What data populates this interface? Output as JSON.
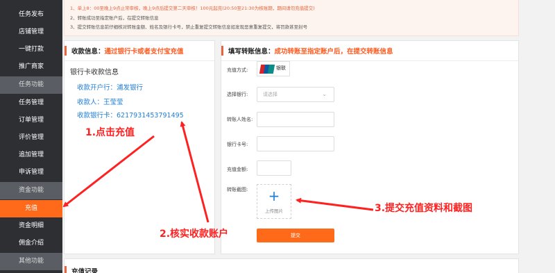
{
  "sidebar": {
    "items": [
      {
        "label": "任务发布",
        "type": "item"
      },
      {
        "label": "店铺管理",
        "type": "item"
      },
      {
        "label": "一键打款",
        "type": "item"
      },
      {
        "label": "推广商家",
        "type": "item"
      },
      {
        "label": "任务功能",
        "type": "section"
      },
      {
        "label": "任务管理",
        "type": "item"
      },
      {
        "label": "订单管理",
        "type": "item"
      },
      {
        "label": "评价管理",
        "type": "item"
      },
      {
        "label": "追加管理",
        "type": "item"
      },
      {
        "label": "申诉管理",
        "type": "item"
      },
      {
        "label": "资金功能",
        "type": "section"
      },
      {
        "label": "充值",
        "type": "active"
      },
      {
        "label": "资金明细",
        "type": "item"
      },
      {
        "label": "佣金介绍",
        "type": "item"
      },
      {
        "label": "其他功能",
        "type": "section"
      }
    ]
  },
  "notice": {
    "lines": [
      "1、单上8：00至晚上9点止常审核，晚上9点后提交第二天审核！100元起充(20:50至21:30为核账期，期间请勿充值提交)",
      "2、转账成功至指定账户后，在提交转账信息",
      "3、提交转账信息前仔细核对转账金额、姓名及银行卡号，禁止重复提交转账信息如发现恶意重复提交，将罚款甚至封号"
    ]
  },
  "receive_panel": {
    "title": "收款信息：",
    "title_highlight": "通过银行卡或者支付宝充值",
    "heading": "银行卡收款信息",
    "bank_line": "收款开户行：浦发银行",
    "payee_line": "收款人：王莹莹",
    "card_line": "收款银行卡：6217931453791495"
  },
  "transfer_panel": {
    "title": "填写转账信息：",
    "title_highlight": "成功转账至指定账户后，在提交转账信息",
    "method_label": "充值方式:",
    "method_value": "银联",
    "bank_label": "选择银行:",
    "bank_placeholder": "请选择",
    "name_label": "转账人姓名:",
    "card_label": "银行卡号:",
    "amount_label": "充值金额:",
    "screenshot_label": "转账截图:",
    "upload_text": "上传图片",
    "submit_label": "提交"
  },
  "records_panel": {
    "title": "充值记录"
  },
  "annotations": {
    "step1": "1.点击充值",
    "step2": "2.核实收款账户",
    "step3": "3.提交充值资料和截图"
  },
  "colors": {
    "accent": "#ff6a1a",
    "annotation": "#ff2020",
    "link_blue": "#1e7ed8",
    "sidebar_bg": "#2d2f33"
  }
}
